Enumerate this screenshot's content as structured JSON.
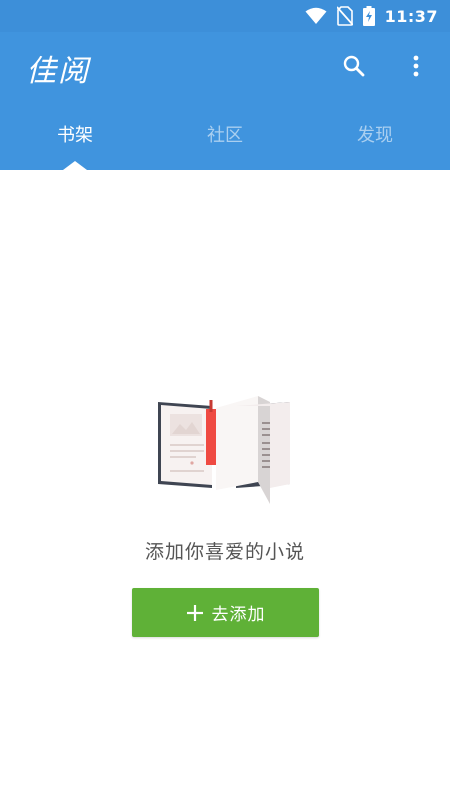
{
  "status_bar": {
    "time": "11:37",
    "icons": [
      "wifi-icon",
      "no-sim-icon",
      "battery-charging-icon"
    ]
  },
  "app_bar": {
    "title": "佳阅",
    "actions": [
      "search-icon",
      "more-vert-icon"
    ]
  },
  "tabs": [
    {
      "label": "书架",
      "active": true
    },
    {
      "label": "社区",
      "active": false
    },
    {
      "label": "发现",
      "active": false
    }
  ],
  "empty_state": {
    "illustration": "open-book-illustration",
    "message": "添加你喜爱的小说",
    "button_label": "去添加",
    "button_icon": "plus-icon"
  },
  "colors": {
    "status_bar": "#3d8fd9",
    "app_bar": "#4094de",
    "accent_button": "#5fb137",
    "bookmark": "#ef4a42"
  }
}
